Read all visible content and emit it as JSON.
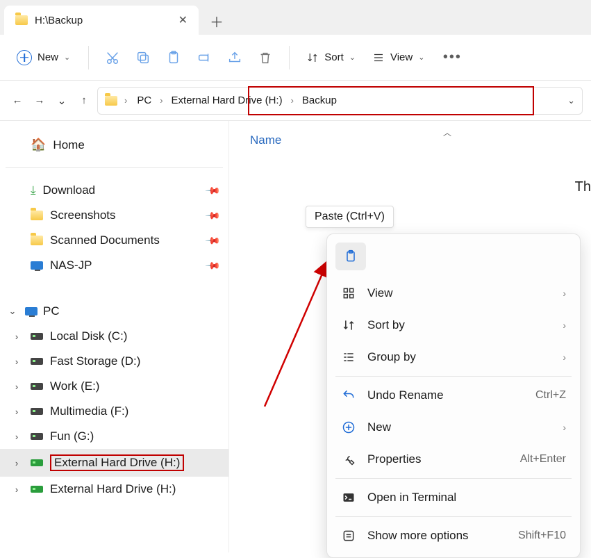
{
  "tab": {
    "title": "H:\\Backup"
  },
  "toolbar": {
    "new_label": "New",
    "sort_label": "Sort",
    "view_label": "View"
  },
  "breadcrumb": {
    "seg1": "PC",
    "seg2": "External Hard Drive (H:)",
    "seg3": "Backup"
  },
  "sidebar": {
    "home": "Home",
    "quick": [
      {
        "label": "Download"
      },
      {
        "label": "Screenshots"
      },
      {
        "label": "Scanned Documents"
      },
      {
        "label": "NAS-JP"
      }
    ],
    "pc": "PC",
    "drives": [
      {
        "label": "Local Disk (C:)"
      },
      {
        "label": "Fast Storage (D:)"
      },
      {
        "label": "Work (E:)"
      },
      {
        "label": "Multimedia (F:)"
      },
      {
        "label": "Fun (G:)"
      },
      {
        "label": "External Hard Drive (H:)"
      },
      {
        "label": "External Hard Drive (H:)"
      }
    ]
  },
  "columns": {
    "name": "Name"
  },
  "empty_text": "Th",
  "tooltip": "Paste (Ctrl+V)",
  "context_menu": {
    "view": "View",
    "sortby": "Sort by",
    "groupby": "Group by",
    "undo": "Undo Rename",
    "undo_accel": "Ctrl+Z",
    "new": "New",
    "properties": "Properties",
    "properties_accel": "Alt+Enter",
    "terminal": "Open in Terminal",
    "more": "Show more options",
    "more_accel": "Shift+F10"
  }
}
